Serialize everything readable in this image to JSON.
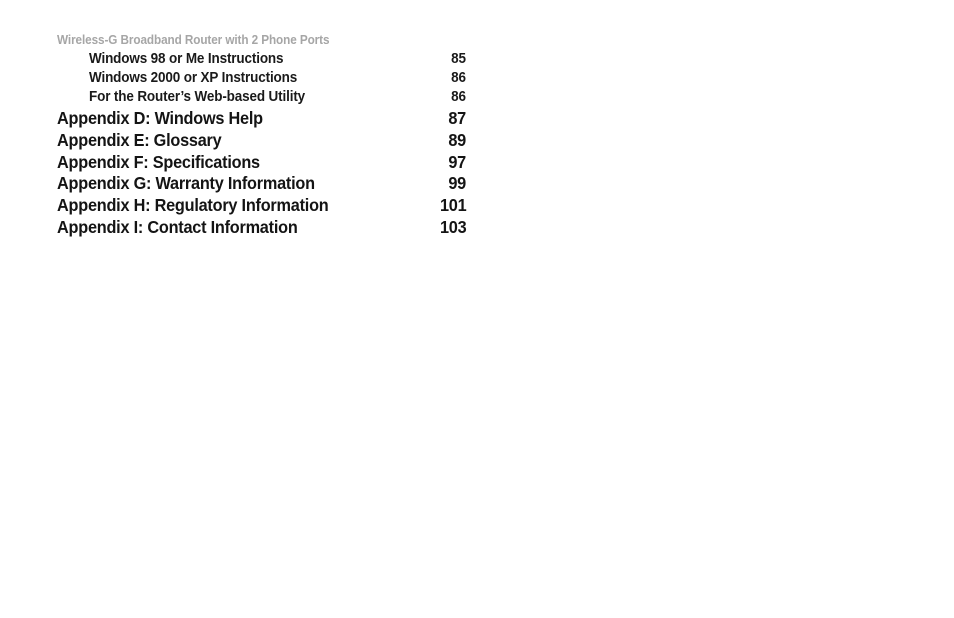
{
  "document": {
    "running_header": "Wireless-G Broadband Router with 2 Phone Ports"
  },
  "toc": {
    "entries": [
      {
        "level": "sub",
        "title": "Windows 98 or Me Instructions",
        "page": "85"
      },
      {
        "level": "sub",
        "title": "Windows 2000 or XP Instructions",
        "page": "86"
      },
      {
        "level": "sub",
        "title": "For the Router’s Web-based Utility",
        "page": "86"
      },
      {
        "level": "main",
        "title": "Appendix D: Windows Help",
        "page": "87"
      },
      {
        "level": "main",
        "title": "Appendix E: Glossary",
        "page": "89"
      },
      {
        "level": "main",
        "title": "Appendix F: Specifications",
        "page": "97"
      },
      {
        "level": "main",
        "title": "Appendix G: Warranty Information",
        "page": "99"
      },
      {
        "level": "main",
        "title": "Appendix H: Regulatory Information",
        "page": "101"
      },
      {
        "level": "main",
        "title": "Appendix I: Contact Information",
        "page": "103"
      }
    ]
  },
  "colors": {
    "page_background": "#ffffff",
    "header_gray": "#a6a6a6",
    "body_text": "#141414"
  }
}
